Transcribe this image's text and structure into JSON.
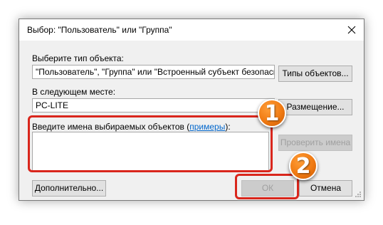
{
  "window": {
    "title": "Выбор: \"Пользователь\" или \"Группа\""
  },
  "object_type": {
    "label": "Выберите тип объекта:",
    "value": "\"Пользователь\", \"Группа\" или \"Встроенный субъект безопасности\"",
    "button_label": "Типы объектов..."
  },
  "location": {
    "label": "В следующем месте:",
    "value": "PC-LITE",
    "button_label": "Размещение..."
  },
  "names": {
    "label_prefix": "Введите имена выбираемых объектов (",
    "examples_link": "примеры",
    "label_suffix": "):",
    "value": "",
    "check_button_label": "Проверить имена"
  },
  "footer": {
    "advanced_label": "Дополнительно...",
    "ok_label": "ОК",
    "cancel_label": "Отмена"
  },
  "annotations": {
    "step1": "1",
    "step2": "2",
    "highlight_color": "#d9261c",
    "badge_color": "#f07a12"
  }
}
